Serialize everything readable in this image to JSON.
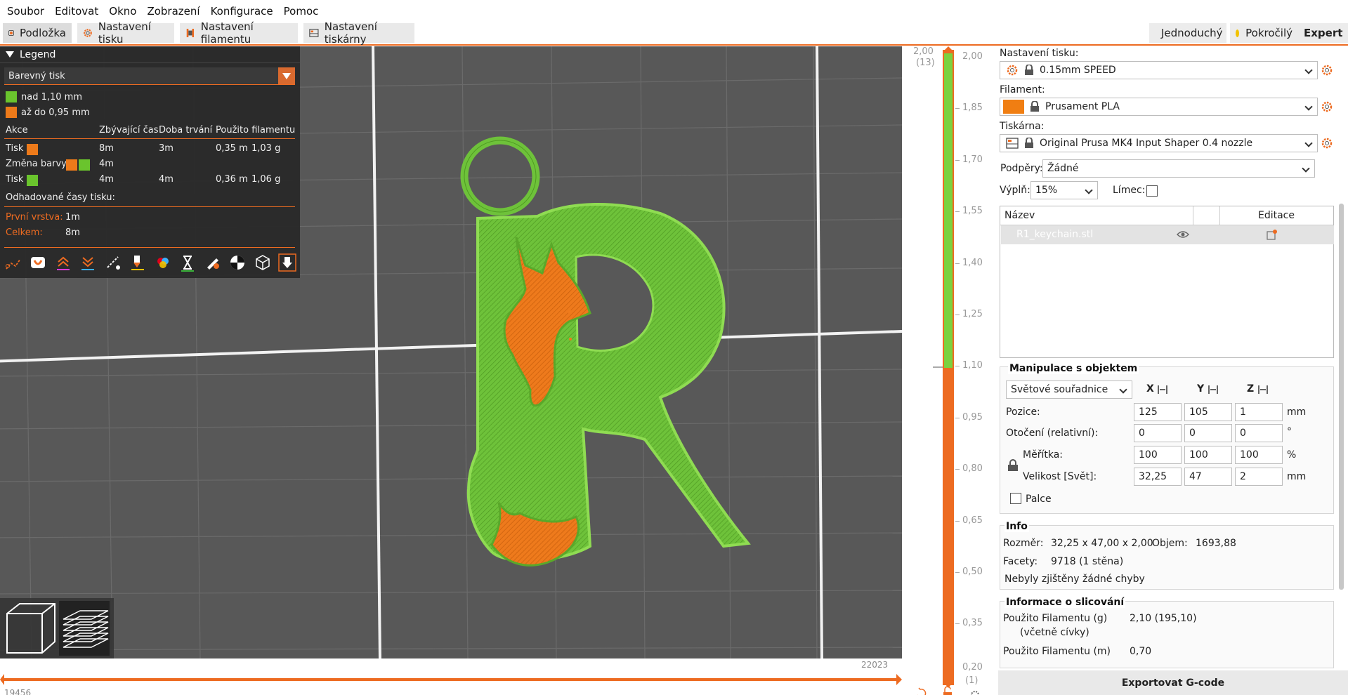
{
  "menu": [
    "Soubor",
    "Editovat",
    "Okno",
    "Zobrazení",
    "Konfigurace",
    "Pomoc"
  ],
  "tabs": [
    {
      "label": "Podložka",
      "icon": "plater-icon"
    },
    {
      "label": "Nastavení tisku",
      "icon": "gear-icon"
    },
    {
      "label": "Nastavení filamentu",
      "icon": "spool-icon"
    },
    {
      "label": "Nastavení tiskárny",
      "icon": "printer-icon"
    }
  ],
  "modes": [
    {
      "label": "Jednoduchý",
      "color": "#3bb33b"
    },
    {
      "label": "Pokročilý",
      "color": "#f2c200"
    },
    {
      "label": "Expert",
      "color": "#e0001b"
    }
  ],
  "legend": {
    "title": "Legend",
    "view_type": "Barevný tisk",
    "items": [
      {
        "label": "nad 1,10 mm",
        "color": "#6ac42d"
      },
      {
        "label": "až do 0,95 mm",
        "color": "#ed7a1a"
      }
    ],
    "columns": [
      "Akce",
      "Zbývající čas",
      "Doba trvání",
      "Použito filamentu"
    ],
    "rows": [
      {
        "action": "Tisk",
        "remaining": "8m",
        "duration": "3m",
        "length": "0,35 m",
        "weight": "1,03 g"
      },
      {
        "action": "Změna barvy",
        "remaining": "4m",
        "duration": "",
        "length": "",
        "weight": ""
      },
      {
        "action": "Tisk",
        "remaining": "4m",
        "duration": "4m",
        "length": "0,36 m",
        "weight": "1,06 g"
      }
    ],
    "estimated_title": "Odhadované časy tisku:",
    "first_layer_label": "První vrstva:",
    "first_layer_value": "1m",
    "total_label": "Celkem:",
    "total_value": "8m"
  },
  "slider": {
    "top_value": "2,00",
    "top_layer": "(13)",
    "bottom_value": "0,20",
    "bottom_layer": "(1)",
    "ticks": [
      "2,00",
      "1,85",
      "1,70",
      "1,55",
      "1,40",
      "1,25",
      "1,10",
      "0,95",
      "0,80",
      "0,65",
      "0,50",
      "0,35",
      "0,20"
    ],
    "h_right": "22023",
    "h_left": "19456"
  },
  "panel": {
    "print_settings_label": "Nastavení tisku:",
    "print_profile": "0.15mm SPEED",
    "filament_label": "Filament:",
    "filament_profile": "Prusament PLA",
    "filament_color": "#f07e12",
    "printer_label": "Tiskárna:",
    "printer_profile": "Original Prusa MK4 Input Shaper 0.4 nozzle",
    "supports_label": "Podpěry:",
    "supports_value": "Žádné",
    "infill_label": "Výplň:",
    "infill_value": "15%",
    "brim_label": "Límec:",
    "table_name": "Název",
    "table_edit": "Editace",
    "object_name": "R1_keychain.stl"
  },
  "manip": {
    "title": "Manipulace s objektem",
    "coord_system": "Světové souřadnice",
    "axes": [
      "X",
      "Y",
      "Z"
    ],
    "position_label": "Pozice:",
    "position": [
      "125",
      "105",
      "1"
    ],
    "position_unit": "mm",
    "rotation_label": "Otočení (relativní):",
    "rotation": [
      "0",
      "0",
      "0"
    ],
    "rotation_unit": "°",
    "scale_label": "Měřítka:",
    "scale": [
      "100",
      "100",
      "100"
    ],
    "scale_unit": "%",
    "size_label": "Velikost [Svět]:",
    "size": [
      "32,25",
      "47",
      "2"
    ],
    "size_unit": "mm",
    "inches_label": "Palce"
  },
  "info": {
    "title": "Info",
    "size_label": "Rozměr:",
    "size_value": "32,25 x 47,00 x 2,00",
    "volume_label": "Objem:",
    "volume_value": "1693,88",
    "facets_label": "Facety:",
    "facets_value": "9718 (1 stěna)",
    "errors": "Nebyly zjištěny žádné chyby"
  },
  "slice": {
    "title": "Informace o slicování",
    "filament_g_label": "Použito Filamentu (g)",
    "filament_g_sub": "(včetně cívky)",
    "filament_g_value": "2,10 (195,10)",
    "filament_m_label": "Použito Filamentu (m)",
    "filament_m_value": "0,70"
  },
  "export_label": "Exportovat G-code",
  "colors": {
    "accent": "#ed6b21",
    "green": "#6ac42d",
    "bed": "#585858"
  }
}
